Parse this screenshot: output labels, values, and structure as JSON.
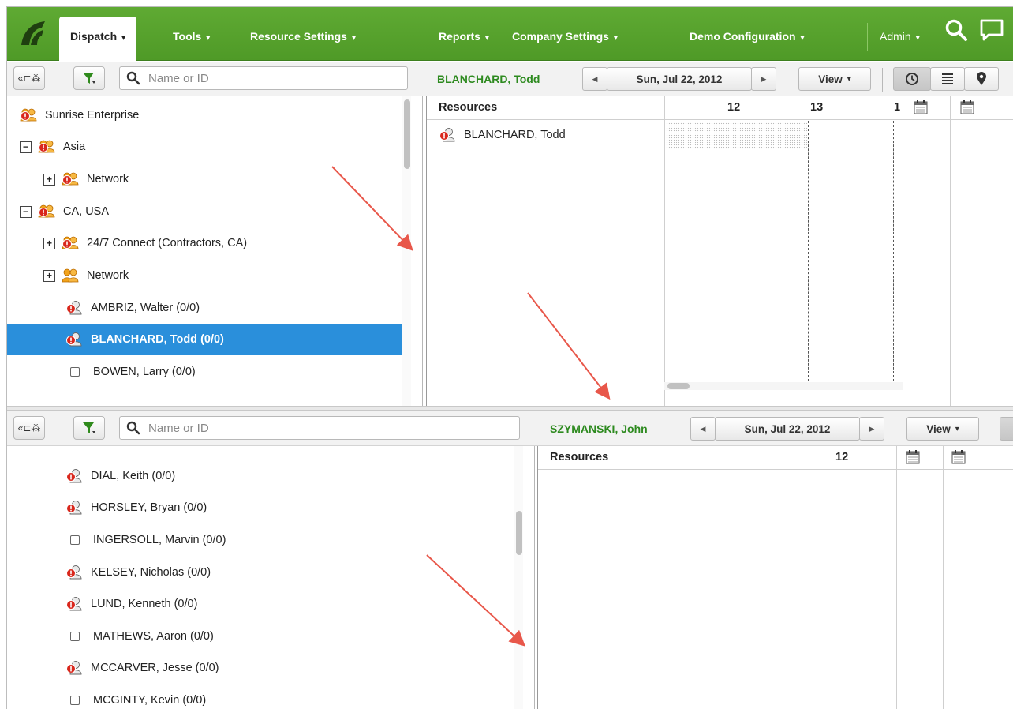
{
  "nav": {
    "items": [
      {
        "label": "Dispatch",
        "active": true
      },
      {
        "label": "Tools",
        "active": false
      },
      {
        "label": "Resource Settings",
        "active": false
      },
      {
        "label": "Reports",
        "active": false
      },
      {
        "label": "Company Settings",
        "active": false
      },
      {
        "label": "Demo Configuration",
        "active": false
      }
    ],
    "admin_label": "Admin",
    "caret": "▾"
  },
  "top_panel": {
    "search_placeholder": "Name or ID",
    "tree": [
      {
        "label": "Sunrise Enterprise",
        "icon": "group-alert-icon",
        "expander": ""
      },
      {
        "label": "Asia",
        "icon": "group-alert-icon",
        "expander": "−"
      },
      {
        "label": "Network",
        "icon": "group-alert-icon",
        "expander": "+"
      },
      {
        "label": "CA, USA",
        "icon": "group-alert-icon",
        "expander": "−"
      },
      {
        "label": "24/7 Connect (Contractors, CA)",
        "icon": "group-alert-icon",
        "expander": "+"
      },
      {
        "label": "Network",
        "icon": "group-icon",
        "expander": "+"
      },
      {
        "label": "AMBRIZ, Walter (0/0)",
        "icon": "person-alert-icon",
        "expander": ""
      },
      {
        "label": "BLANCHARD, Todd (0/0)",
        "icon": "person-alert-icon",
        "expander": "",
        "selected": true
      },
      {
        "label": "BOWEN, Larry (0/0)",
        "icon": "checkbox-icon",
        "expander": ""
      }
    ],
    "resource_name": "BLANCHARD, Todd",
    "date": "Sun, Jul 22, 2012",
    "view_label": "View",
    "grid": {
      "resources_header": "Resources",
      "hours": [
        "12",
        "13",
        "1"
      ],
      "rows": [
        "BLANCHARD, Todd"
      ]
    }
  },
  "bottom_panel": {
    "search_placeholder": "Name or ID",
    "tree": [
      {
        "label": "DIAL, Keith (0/0)",
        "icon": "person-alert-icon"
      },
      {
        "label": "HORSLEY, Bryan (0/0)",
        "icon": "person-alert-icon"
      },
      {
        "label": "INGERSOLL, Marvin (0/0)",
        "icon": "checkbox-icon"
      },
      {
        "label": "KELSEY, Nicholas (0/0)",
        "icon": "person-alert-icon"
      },
      {
        "label": "LUND, Kenneth (0/0)",
        "icon": "person-alert-icon"
      },
      {
        "label": "MATHEWS, Aaron (0/0)",
        "icon": "checkbox-icon"
      },
      {
        "label": "MCCARVER, Jesse (0/0)",
        "icon": "person-alert-icon"
      },
      {
        "label": "MCGINTY, Kevin (0/0)",
        "icon": "checkbox-icon"
      }
    ],
    "resource_name": "SZYMANSKI, John",
    "date": "Sun, Jul 22, 2012",
    "view_label": "View",
    "grid": {
      "resources_header": "Resources",
      "hours": [
        "12"
      ]
    }
  },
  "colors": {
    "nav_green": "#55a22d",
    "resource_name_green": "#2d8a1f",
    "selected_blue": "#2a8fdb",
    "annotation_arrow": "#e8574a"
  }
}
